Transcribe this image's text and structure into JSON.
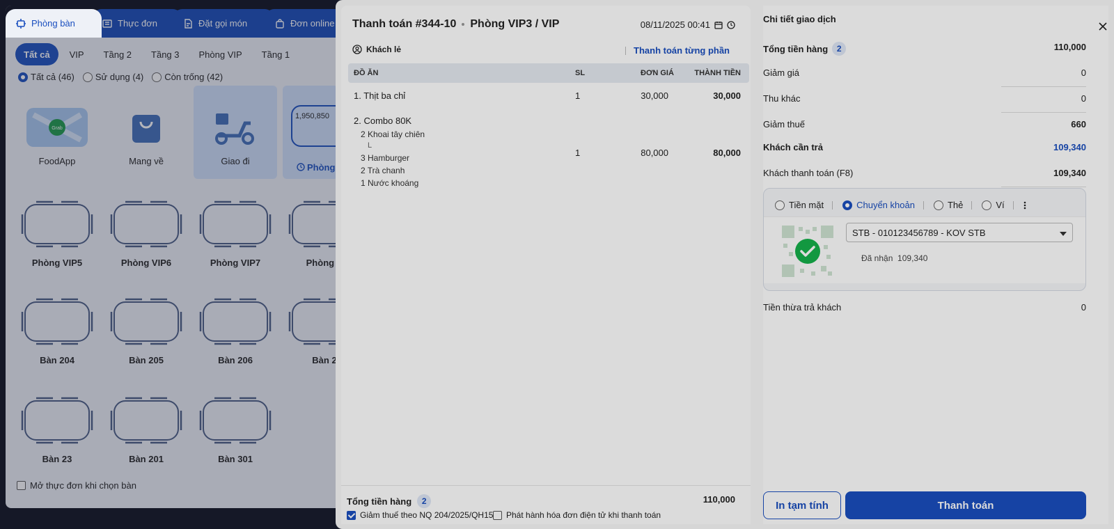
{
  "main_tabs": [
    {
      "label": "Phòng bàn",
      "icon": "table-icon"
    },
    {
      "label": "Thực đơn",
      "icon": "menu-icon"
    },
    {
      "label": "Đặt gọi món",
      "icon": "order-icon"
    },
    {
      "label": "Đơn online",
      "icon": "bag-icon"
    }
  ],
  "floor_tabs": [
    "Tất cả",
    "VIP",
    "Tầng 2",
    "Tầng 3",
    "Phòng VIP",
    "Tầng 1"
  ],
  "status_filters": [
    "Tất cả (46)",
    "Sử dụng (4)",
    "Còn trống (42)"
  ],
  "services": [
    {
      "label": "FoodApp"
    },
    {
      "label": "Mang về"
    },
    {
      "label": "Giao đi"
    },
    {
      "label": "Phòng",
      "amount": "1,950,850"
    }
  ],
  "tables": [
    "Phòng VIP5",
    "Phòng VIP6",
    "Phòng VIP7",
    "Phòng V",
    "Bàn 204",
    "Bàn 205",
    "Bàn 206",
    "Bàn 2",
    "Bàn 23",
    "Bàn 201",
    "Bàn 301"
  ],
  "open_menu_label": "Mở thực đơn khi chọn bàn",
  "dialog": {
    "title": "Thanh toán #344-10",
    "room": "Phòng VIP3 / VIP",
    "datetime": "08/11/2025 00:41",
    "customer": "Khách lẻ",
    "partial_pay": "Thanh toán từng phần",
    "columns": [
      "ĐỒ ĂN",
      "SL",
      "ĐƠN GIÁ",
      "THÀNH TIỀN"
    ],
    "items": [
      {
        "name": "1. Thịt ba chỉ",
        "qty": "1",
        "price": "30,000",
        "total": "30,000",
        "subs": []
      },
      {
        "name": "2. Combo 80K",
        "qty": "1",
        "price": "80,000",
        "total": "80,000",
        "subs": [
          "2 Khoai tây chiên",
          "L",
          "3 Hamburger",
          "2 Trà chanh",
          "1 Nước khoáng"
        ]
      }
    ],
    "footer": {
      "total_label": "Tổng tiền hàng",
      "count": "2",
      "total": "110,000",
      "tax_check": "Giảm thuế theo NQ 204/2025/QH15",
      "invoice_check": "Phát hành hóa đơn điện tử khi thanh toán"
    }
  },
  "summary": {
    "title": "Chi tiết giao dịch",
    "total_label": "Tổng tiền hàng",
    "count": "2",
    "total": "110,000",
    "discount_label": "Giảm giá",
    "discount": "0",
    "other_label": "Thu khác",
    "other": "0",
    "tax_label": "Giảm thuế",
    "tax": "660",
    "due_label": "Khách cần trả",
    "due": "109,340",
    "paid_label": "Khách thanh toán (F8)",
    "paid": "109,340",
    "methods": [
      "Tiền mặt",
      "Chuyển khoản",
      "Thẻ",
      "Ví"
    ],
    "bank": "STB - 010123456789 - KOV STB",
    "received_label": "Đã nhận",
    "received": "109,340",
    "change_label": "Tiền thừa trả khách",
    "change": "0",
    "print_button": "In tạm tính",
    "pay_button": "Thanh toán"
  },
  "colors": {
    "primary": "#1a4fbf",
    "success": "#16b24b"
  }
}
